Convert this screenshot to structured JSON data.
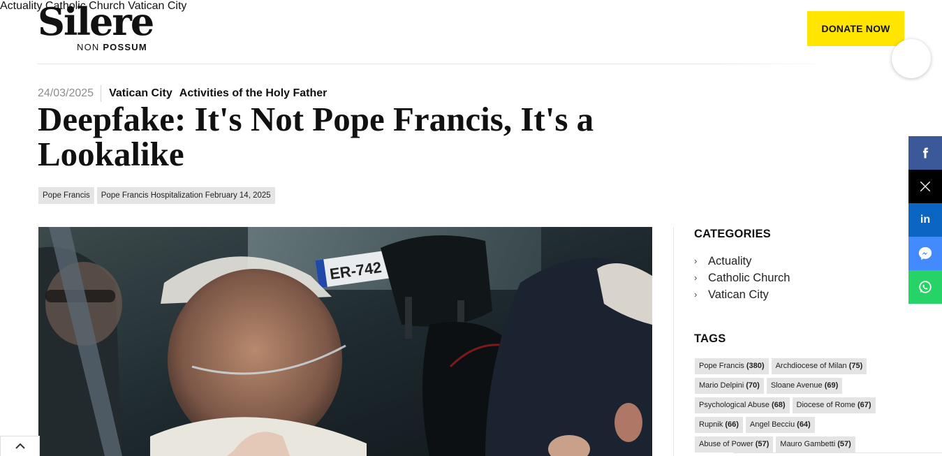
{
  "logo": {
    "main": "Silere",
    "sub_light": "NON",
    "sub_bold": "POSSUM"
  },
  "nav": {
    "items": [
      "Actuality",
      "Catholic Church",
      "Vatican City"
    ],
    "donate": "DONATE NOW"
  },
  "article": {
    "date": "24/03/2025",
    "category": "Vatican City",
    "subcategory": "Activities of the Holy Father",
    "title": "Deepfake: It's Not Pope Francis, It's a Lookalike",
    "chips": [
      "Pope Francis",
      "Pope Francis Hospitalization February 14, 2025"
    ]
  },
  "sidebar": {
    "categories_heading": "CATEGORIES",
    "categories": [
      "Actuality",
      "Catholic Church",
      "Vatican City"
    ],
    "tags_heading": "TAGS",
    "tag_rows": [
      [
        {
          "name": "Pope Francis",
          "count": "(380)"
        },
        {
          "name": "Archdiocese of Milan",
          "count": "(75)"
        }
      ],
      [
        {
          "name": "Mario Delpini",
          "count": "(70)"
        },
        {
          "name": "Sloane Avenue",
          "count": "(69)"
        }
      ],
      [
        {
          "name": "Psychological Abuse",
          "count": "(68)"
        },
        {
          "name": "Diocese of Rome",
          "count": "(67)"
        }
      ],
      [
        {
          "name": "Rupnik",
          "count": "(66)"
        },
        {
          "name": "Angel Becciu",
          "count": "(64)"
        }
      ],
      [
        {
          "name": "Abuse of Power",
          "count": "(57)"
        },
        {
          "name": "Mauro Gambetti",
          "count": "(57)"
        }
      ]
    ]
  },
  "share": {
    "icons": [
      "facebook-icon",
      "x-icon",
      "linkedin-icon",
      "messenger-icon",
      "whatsapp-icon"
    ],
    "colors": {
      "facebook": "#3b5998",
      "x": "#000000",
      "linkedin": "#0a66c2",
      "messenger": "#448aff",
      "whatsapp": "#25d366"
    }
  },
  "colors": {
    "donate_bg": "#ffe500",
    "chip_bg": "#e4e4e4",
    "date_gray": "#8c8c8c"
  },
  "hero": {
    "plate_text": "ER-742"
  }
}
